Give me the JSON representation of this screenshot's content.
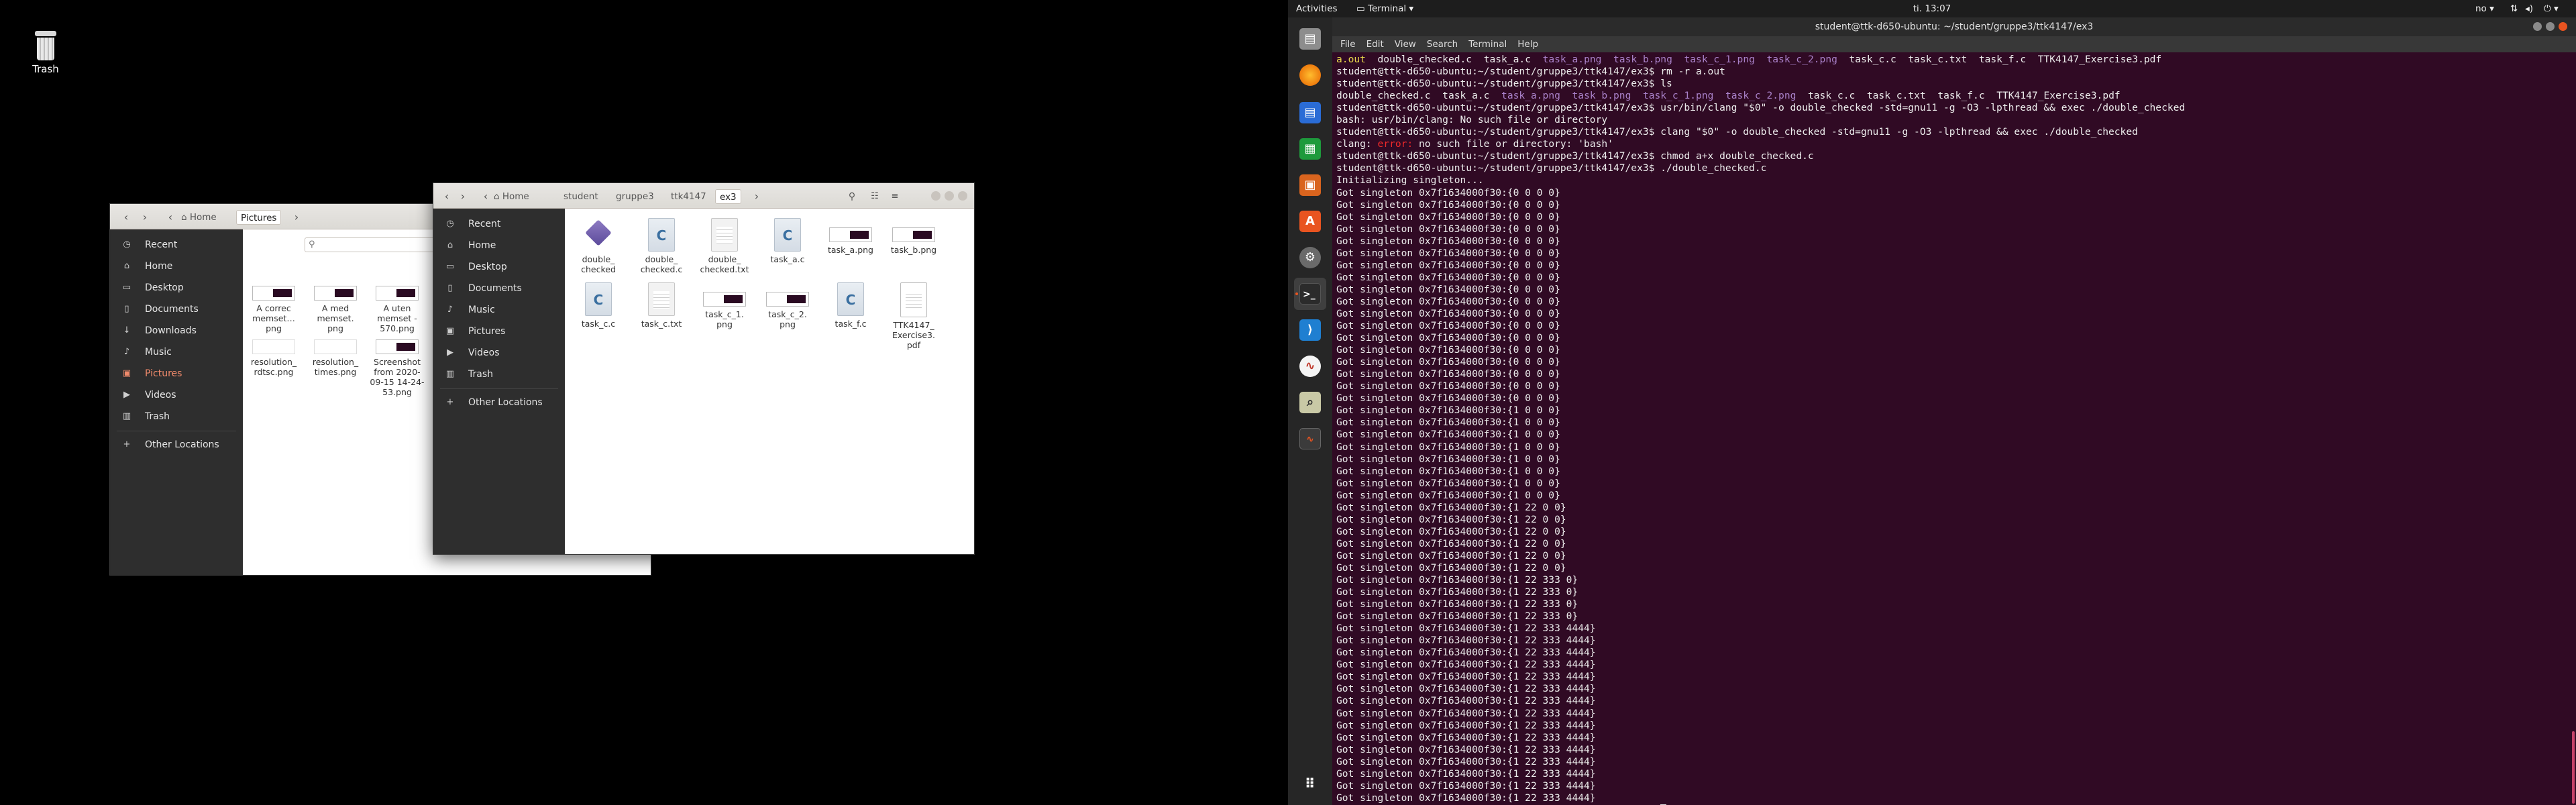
{
  "desktop": {
    "trash_label": "Trash"
  },
  "fm_back": {
    "crumbs": [
      "Home",
      "Pictures"
    ],
    "search_placeholder": "",
    "sidebar": [
      "Recent",
      "Home",
      "Desktop",
      "Documents",
      "Downloads",
      "Music",
      "Pictures",
      "Videos",
      "Trash",
      "Other Locations"
    ],
    "files": [
      {
        "name": "A correc\nmemset…\npng"
      },
      {
        "name": "A med\nmemset.\npng"
      },
      {
        "name": "A uten\nmemset -\n570.png"
      },
      {
        "name": "resolution_\nrdtsc.png"
      },
      {
        "name": "resolution_\ntimes.png"
      },
      {
        "name": "Screenshot\nfrom 2020-\n09-15 14-24-\n53.png"
      }
    ]
  },
  "fm_front": {
    "crumbs": [
      "Home",
      "student",
      "gruppe3",
      "ttk4147",
      "ex3"
    ],
    "sidebar": [
      "Recent",
      "Home",
      "Desktop",
      "Documents",
      "Music",
      "Pictures",
      "Videos",
      "Trash",
      "Other Locations"
    ],
    "files": [
      {
        "name": "double_\nchecked",
        "kind": "exe"
      },
      {
        "name": "double_\nchecked.c",
        "kind": "c"
      },
      {
        "name": "double_\nchecked.txt",
        "kind": "doc"
      },
      {
        "name": "task_a.c",
        "kind": "c"
      },
      {
        "name": "task_a.png",
        "kind": "png"
      },
      {
        "name": "task_b.png",
        "kind": "png"
      },
      {
        "name": "task_c.c",
        "kind": "c"
      },
      {
        "name": "task_c.txt",
        "kind": "doc"
      },
      {
        "name": "task_c_1.\npng",
        "kind": "png"
      },
      {
        "name": "task_c_2.\npng",
        "kind": "png"
      },
      {
        "name": "task_f.c",
        "kind": "c"
      },
      {
        "name": "TTK4147_\nExercise3.\npdf",
        "kind": "pdf"
      }
    ]
  },
  "topbar": {
    "activities": "Activities",
    "app_menu": "Terminal",
    "clock": "ti. 13:07",
    "keyboard": "no"
  },
  "terminal": {
    "title": "student@ttk-d650-ubuntu: ~/student/gruppe3/ttk4147/ex3",
    "menu": [
      "File",
      "Edit",
      "View",
      "Search",
      "Terminal",
      "Help"
    ],
    "prompt": "student@ttk-d650-ubuntu:~/student/gruppe3/ttk4147/ex3$ ",
    "lines": [
      {
        "t": "y",
        "v": "a.out"
      },
      {
        "t": "ls1",
        "v": ""
      },
      {
        "t": "cmd",
        "v": "rm -r a.out"
      },
      {
        "t": "cmd",
        "v": "ls"
      },
      {
        "t": "ls2",
        "v": ""
      },
      {
        "t": "cmd",
        "v": "usr/bin/clang \"$0\" -o double_checked -std=gnu11 -g -O3 -lpthread && exec ./double_checked"
      },
      {
        "t": "out",
        "v": "bash: usr/bin/clang: No such file or directory"
      },
      {
        "t": "cmd",
        "v": "clang \"$0\" -o double_checked -std=gnu11 -g -O3 -lpthread && exec ./double_checked"
      },
      {
        "t": "err",
        "v": "no such file or directory: 'bash'"
      },
      {
        "t": "cmd",
        "v": "chmod a+x double_checked.c"
      },
      {
        "t": "cmd",
        "v": "./double_checked.c"
      },
      {
        "t": "out",
        "v": "Initializing singleton..."
      }
    ],
    "ls1_items": [
      "double_checked.c",
      "task_a.c",
      "task_a.png",
      "task_b.png",
      "task_c_1.png",
      "task_c_2.png",
      "task_c.c",
      "task_c.txt",
      "task_f.c",
      "TTK4147_Exercise3.pdf"
    ],
    "ls2_items": [
      "double_checked.c",
      "task_a.c",
      "task_a.png",
      "task_b.png",
      "task_c_1.png",
      "task_c_2.png",
      "task_c.c",
      "task_c.txt",
      "task_f.c",
      "TTK4147_Exercise3.pdf"
    ],
    "singleton_prefix": "Got singleton 0x7f1634000f30:",
    "singleton_runs": [
      {
        "value": "{0 0 0 0}",
        "count": 18
      },
      {
        "value": "{1 0 0 0}",
        "count": 8
      },
      {
        "value": "{1 22 0 0}",
        "count": 6
      },
      {
        "value": "{1 22 333 0}",
        "count": 4
      },
      {
        "value": "{1 22 333 4444}",
        "count": 15
      }
    ],
    "error_word": "error:",
    "err_prefix": "clang: "
  }
}
